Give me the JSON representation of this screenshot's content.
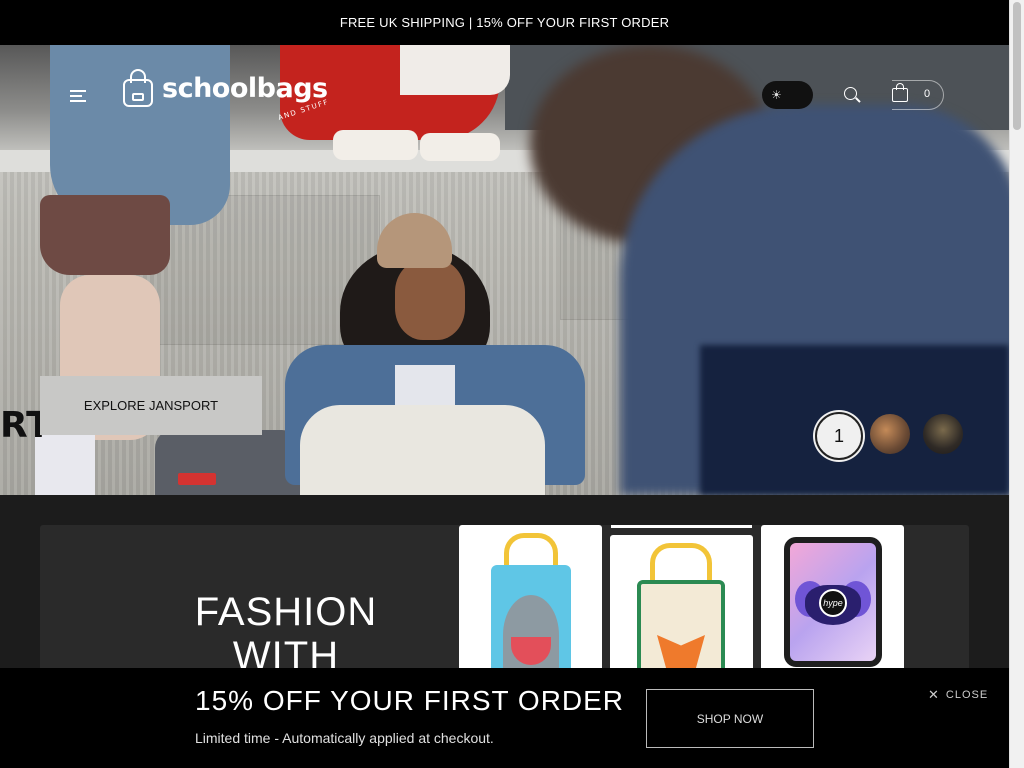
{
  "announcement": {
    "text": "FREE UK SHIPPING | 15% OFF YOUR FIRST ORDER"
  },
  "header": {
    "logo_text": "schoolbags",
    "logo_sub": "AND STUFF",
    "cart_count": "0",
    "icons": [
      "hamburger-menu-icon",
      "sun-icon",
      "search-icon",
      "cart-icon"
    ]
  },
  "hero": {
    "cta_label": "EXPLORE JANSPORT",
    "active_slide": "1",
    "sign_text": "RT"
  },
  "fashion": {
    "title": "FASHION WITH FUNCTION",
    "product_logo": "hype"
  },
  "promo": {
    "title": "15% OFF YOUR FIRST ORDER",
    "subtitle": "Limited time - Automatically applied at checkout.",
    "button_label": "SHOP NOW",
    "close_label": "CLOSE"
  },
  "colors": {
    "background": "#1c1c1c",
    "promo_bg": "#000000",
    "accent_yellow": "#f2c438"
  }
}
